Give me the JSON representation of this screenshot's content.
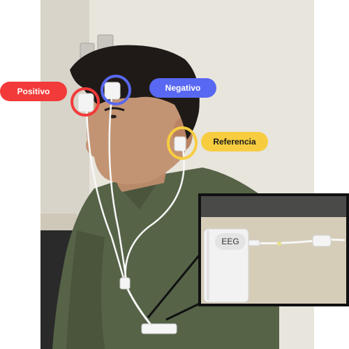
{
  "labels": {
    "positivo": "Positivo",
    "negativo": "Negativo",
    "referencia": "Referencia"
  },
  "inset": {
    "device_label": "EEG"
  },
  "colors": {
    "positivo": "#f23a3a",
    "negativo": "#5968f2",
    "referencia": "#f7cd3f",
    "label_text_dark": "#1a1a1a",
    "label_text_light": "#ffffff",
    "inset_border": "#111111"
  }
}
